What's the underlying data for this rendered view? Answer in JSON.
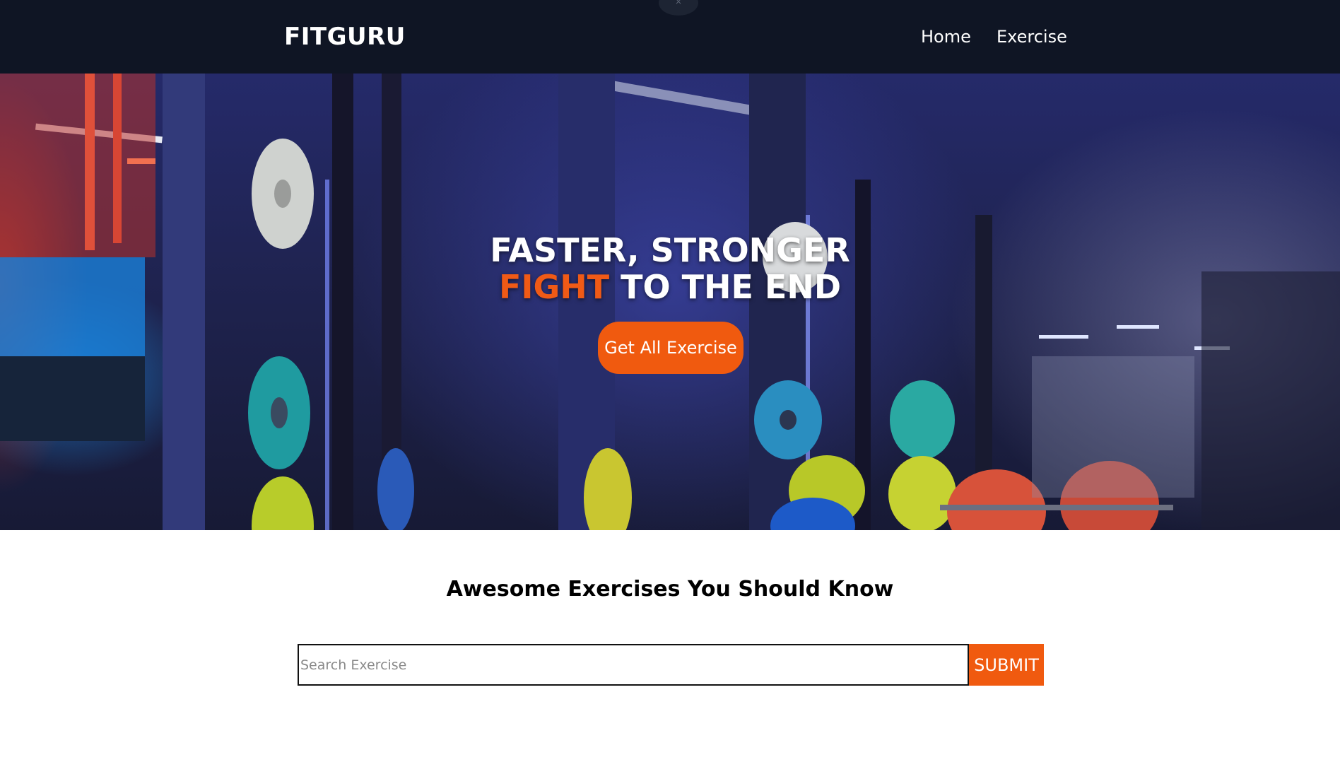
{
  "navbar": {
    "brand": "FITGURU",
    "links": [
      {
        "label": "Home"
      },
      {
        "label": "Exercise"
      }
    ],
    "handle_glyph": "×"
  },
  "hero": {
    "line1": "FASTER, STRONGER",
    "line2_accent": "FIGHT",
    "line2_rest": " TO THE END",
    "cta_label": "Get All Exercise",
    "image_description": "gym-interior-photo"
  },
  "exercises": {
    "title": "Awesome Exercises You Should Know",
    "search": {
      "placeholder": "Search Exercise",
      "value": "",
      "submit_label": "SUBMIT"
    }
  },
  "colors": {
    "nav_bg": "#0f1524",
    "accent": "#f05a0f",
    "text_dark": "#000000",
    "text_light": "#ffffff"
  }
}
